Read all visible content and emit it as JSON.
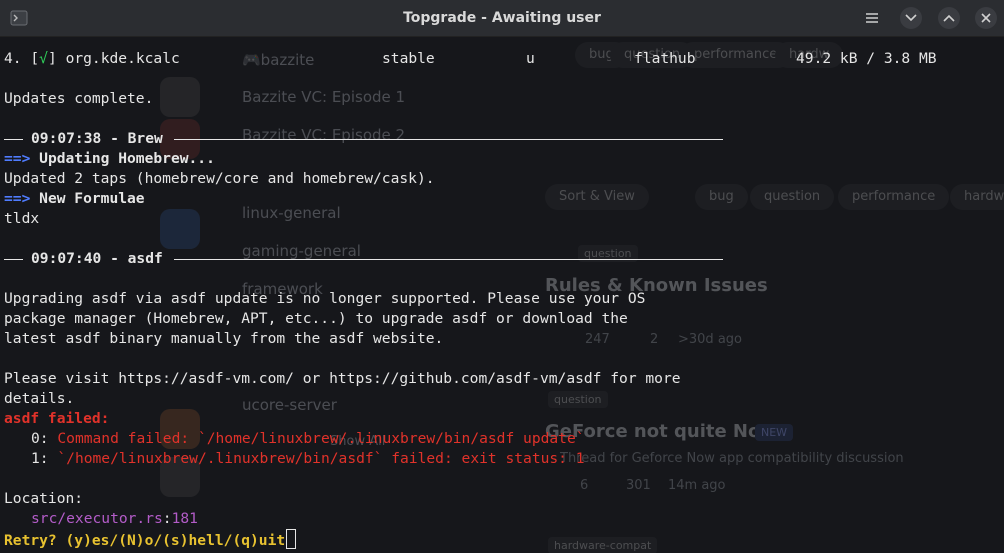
{
  "window": {
    "title": "Topgrade - Awaiting user"
  },
  "background": {
    "channels": [
      "🎮bazzite",
      "Bazzite VC: Episode 1",
      "Bazzite VC: Episode 2",
      "linux-general",
      "gaming-general",
      "framework",
      "ucore-server",
      "Show All"
    ],
    "tags": [
      "Sort & View",
      "bug",
      "question",
      "performance",
      "hardw"
    ],
    "top_tags": [
      "bug",
      "question",
      "performance",
      "hardw"
    ],
    "post1": {
      "tag": "question",
      "title": "Rules & Known Issues",
      "likes": "247",
      "replies": "2",
      "age": ">30d ago"
    },
    "post2": {
      "tag": "question",
      "title": "GeForce not quite Now",
      "badge": "NEW",
      "desc": "Thread for Geforce Now app compatibility discussion",
      "likes": "6",
      "replies": "301",
      "age": "14m ago"
    },
    "post3": {
      "tag": "hardware-compat"
    }
  },
  "terminal": {
    "flatpak_row": {
      "index": "4.",
      "bracket_open": "[",
      "check": "√",
      "bracket_close": "]",
      "app": "org.kde.kcalc",
      "branch": "stable",
      "op": "u",
      "remote": "flathub",
      "size": "49.2 kB / 3.8 MB"
    },
    "updates_complete": "Updates complete.",
    "brew_header": "09:07:38 - Brew",
    "brew_arrow1": "==>",
    "brew_line1": "Updating Homebrew...",
    "brew_line2": "Updated 2 taps (homebrew/core and homebrew/cask).",
    "brew_arrow2": "==>",
    "brew_line3": "New Formulae",
    "brew_line4": "tldx",
    "asdf_header": "09:07:40 - asdf",
    "asdf_msg1": "Upgrading asdf via asdf update is no longer supported. Please use your OS",
    "asdf_msg2": "package manager (Homebrew, APT, etc...) to upgrade asdf or download the",
    "asdf_msg3": "latest asdf binary manually from the asdf website.",
    "asdf_msg4": "Please visit https://asdf-vm.com/ or https://github.com/asdf-vm/asdf for more",
    "asdf_msg5": "details.",
    "failed": "asdf failed:",
    "err0_idx": "0:",
    "err0": "Command failed: `/home/linuxbrew/.linuxbrew/bin/asdf update`",
    "err1_idx": "1:",
    "err1": "`/home/linuxbrew/.linuxbrew/bin/asdf` failed: exit status: 1",
    "location_label": "Location:",
    "location_file": "src/executor.rs",
    "location_sep": ":",
    "location_line": "181",
    "prompt": "Retry? (y)es/(N)o/(s)hell/(q)uit"
  }
}
